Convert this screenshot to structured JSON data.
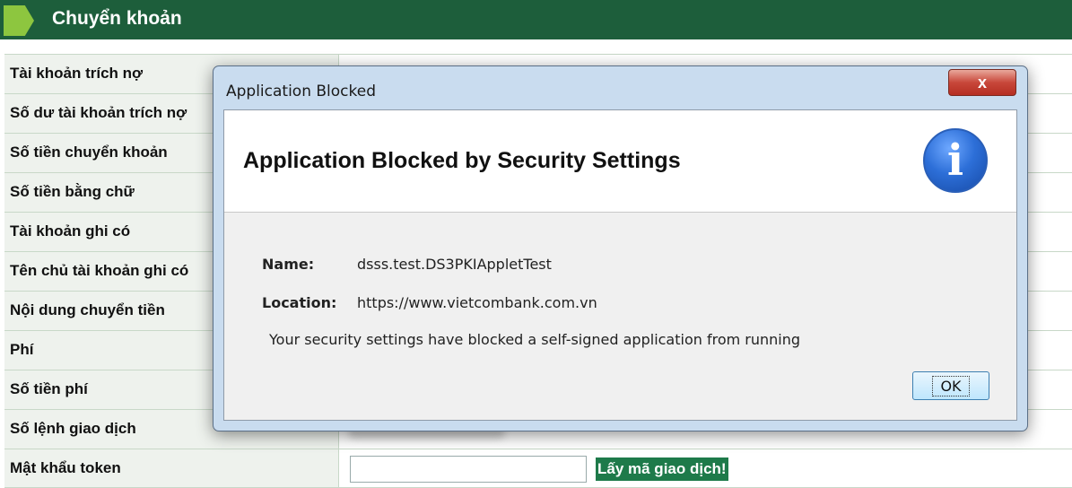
{
  "header": {
    "title": "Chuyển khoản"
  },
  "form": {
    "rows": [
      {
        "label": "Tài khoản trích nợ"
      },
      {
        "label": "Số dư tài khoản trích nợ"
      },
      {
        "label": "Số tiền chuyển khoản"
      },
      {
        "label": "Số tiền bằng chữ"
      },
      {
        "label": "Tài khoản ghi có"
      },
      {
        "label": "Tên chủ tài khoản ghi có"
      },
      {
        "label": "Nội dung chuyển tiền"
      },
      {
        "label": "Phí"
      },
      {
        "label": "Số tiền phí"
      },
      {
        "label": "Số lệnh giao dịch"
      },
      {
        "label": "Mật khẩu token"
      }
    ],
    "token_input_value": "",
    "get_code_label": "Lấy mã giao dịch!"
  },
  "dialog": {
    "title": "Application Blocked",
    "close_label": "x",
    "banner": "Application Blocked by Security Settings",
    "info_icon": "i",
    "name_label": "Name:",
    "name_value": "dsss.test.DS3PKIAppletTest",
    "location_label": "Location:",
    "location_value": "https://www.vietcombank.com.vn",
    "message": "Your security settings have blocked a self-signed application from running",
    "ok_label": "OK"
  },
  "colors": {
    "header_bg": "#1d5e3b",
    "header_tab": "#8dc63f",
    "button_green": "#1e7a4a",
    "dialog_frame": "#c9dcef"
  }
}
